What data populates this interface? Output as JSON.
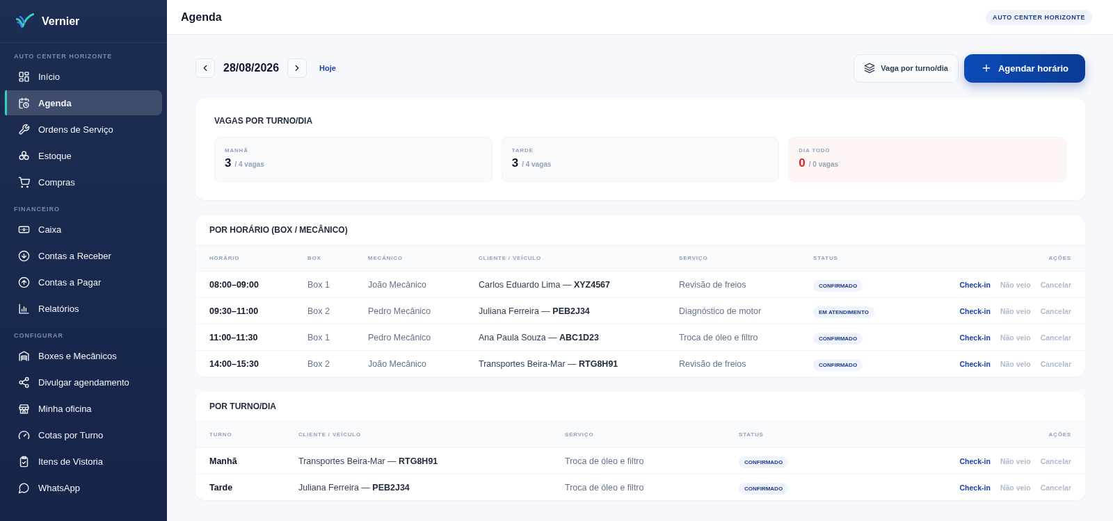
{
  "sidebar": {
    "brand": "Vernier",
    "sections": [
      {
        "label": "AUTO CENTER HORIZONTE",
        "items": [
          {
            "label": "Início",
            "selected": false
          },
          {
            "label": "Agenda",
            "selected": true
          },
          {
            "label": "Ordens de Serviço",
            "selected": false
          },
          {
            "label": "Estoque",
            "selected": false
          },
          {
            "label": "Compras",
            "selected": false
          }
        ]
      },
      {
        "label": "FINANCEIRO",
        "items": [
          {
            "label": "Caixa",
            "selected": false
          },
          {
            "label": "Contas a Receber",
            "selected": false
          },
          {
            "label": "Contas a Pagar",
            "selected": false
          },
          {
            "label": "Relatórios",
            "selected": false
          }
        ]
      },
      {
        "label": "CONFIGURAR",
        "items": [
          {
            "label": "Boxes e Mecânicos",
            "selected": false
          },
          {
            "label": "Divulgar agendamento",
            "selected": false
          },
          {
            "label": "Minha oficina",
            "selected": false
          },
          {
            "label": "Cotas por Turno",
            "selected": false
          },
          {
            "label": "Itens de Vistoria",
            "selected": false
          },
          {
            "label": "WhatsApp",
            "selected": false
          }
        ]
      }
    ]
  },
  "header": {
    "title": "Agenda",
    "badge": "AUTO CENTER HORIZONTE"
  },
  "toolbar": {
    "date": "28/08/2026",
    "today": "Hoje",
    "secondary_button": "Vaga por turno/dia",
    "primary_button": "Agendar horário"
  },
  "quotas": {
    "title": "VAGAS POR TURNO/DIA",
    "cards": [
      {
        "label": "MANHÃ",
        "count": "3",
        "total": "/ 4 vagas",
        "alert": false
      },
      {
        "label": "TARDE",
        "count": "3",
        "total": "/ 4 vagas",
        "alert": false
      },
      {
        "label": "DIA TODO",
        "count": "0",
        "total": "/ 0 vagas",
        "alert": true
      }
    ]
  },
  "by_time": {
    "title": "POR HORÁRIO (BOX / MECÂNICO)",
    "columns": [
      "HORÁRIO",
      "BOX",
      "MECÂNICO",
      "CLIENTE / VEÍCULO",
      "SERVIÇO",
      "STATUS",
      "AÇÕES"
    ],
    "rows": [
      {
        "time": "08:00–09:00",
        "box": "Box 1",
        "mechanic": "João Mecânico",
        "client": "Carlos Eduardo Lima — **XYZ4567**",
        "service": "Revisão de freios",
        "status": "CONFIRMADO",
        "actions": [
          {
            "label": "Check-in",
            "kind": "primary"
          },
          {
            "label": "Não veio",
            "kind": "muted"
          },
          {
            "label": "Cancelar",
            "kind": "muted"
          }
        ]
      },
      {
        "time": "09:30–11:00",
        "box": "Box 2",
        "mechanic": "Pedro Mecânico",
        "client": "Juliana Ferreira — **PEB2J34**",
        "service": "Diagnóstico de motor",
        "status": "EM ATENDIMENTO",
        "actions": [
          {
            "label": "Check-in",
            "kind": "primary"
          },
          {
            "label": "Não veio",
            "kind": "muted"
          },
          {
            "label": "Cancelar",
            "kind": "muted"
          }
        ]
      },
      {
        "time": "11:00–11:30",
        "box": "Box 1",
        "mechanic": "Pedro Mecânico",
        "client": "Ana Paula Souza — **ABC1D23**",
        "service": "Troca de óleo e filtro",
        "status": "CONFIRMADO",
        "actions": [
          {
            "label": "Check-in",
            "kind": "primary"
          },
          {
            "label": "Não veio",
            "kind": "muted"
          },
          {
            "label": "Cancelar",
            "kind": "muted"
          }
        ]
      },
      {
        "time": "14:00–15:30",
        "box": "Box 2",
        "mechanic": "João Mecânico",
        "client": "Transportes Beira-Mar — **RTG8H91**",
        "service": "Revisão de freios",
        "status": "CONFIRMADO",
        "actions": [
          {
            "label": "Check-in",
            "kind": "primary"
          },
          {
            "label": "Não veio",
            "kind": "muted"
          },
          {
            "label": "Cancelar",
            "kind": "muted"
          }
        ]
      }
    ]
  },
  "by_shift": {
    "title": "POR TURNO/DIA",
    "columns": [
      "TURNO",
      "CLIENTE / VEÍCULO",
      "SERVIÇO",
      "STATUS",
      "AÇÕES"
    ],
    "rows": [
      {
        "shift": "Manhã",
        "client": "Transportes Beira-Mar — **RTG8H91**",
        "service": "Troca de óleo e filtro",
        "status": "CONFIRMADO",
        "actions": [
          {
            "label": "Check-in",
            "kind": "primary"
          },
          {
            "label": "Não veio",
            "kind": "muted"
          },
          {
            "label": "Cancelar",
            "kind": "muted"
          }
        ]
      },
      {
        "shift": "Tarde",
        "client": "Juliana Ferreira — **PEB2J34**",
        "service": "Troca de óleo e filtro",
        "status": "CONFIRMADO",
        "actions": [
          {
            "label": "Check-in",
            "kind": "primary"
          },
          {
            "label": "Não veio",
            "kind": "muted"
          },
          {
            "label": "Cancelar",
            "kind": "muted"
          }
        ]
      }
    ]
  }
}
